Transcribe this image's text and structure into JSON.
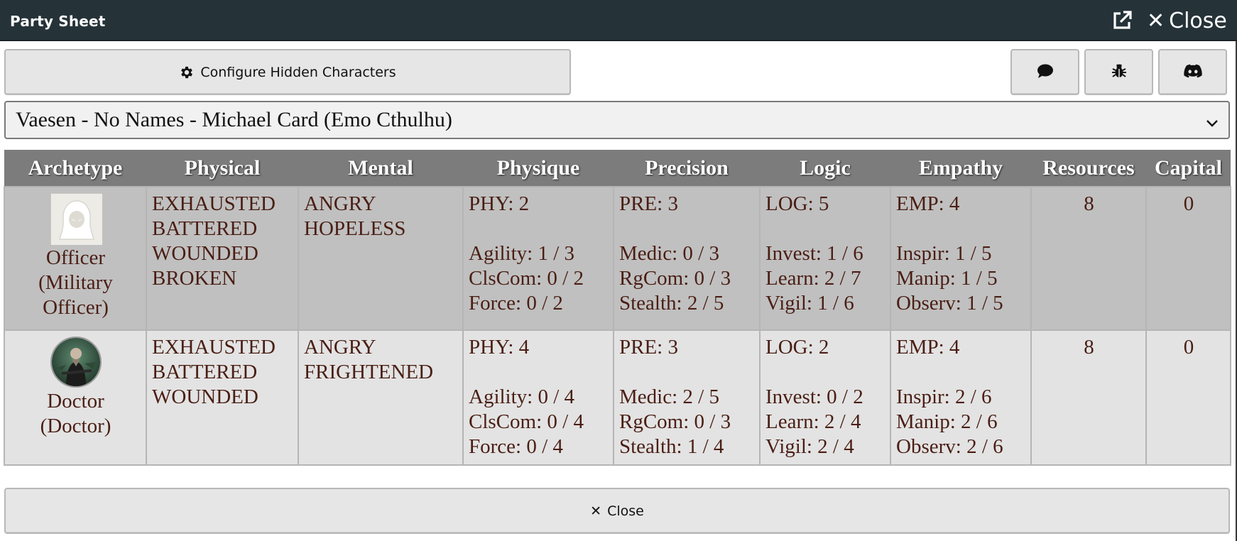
{
  "window": {
    "title": "Party Sheet",
    "close_label": "Close",
    "popout_icon": "external-link-icon",
    "close_icon": "close-icon"
  },
  "toolbar": {
    "configure_label": "Configure Hidden Characters",
    "configure_icon": "gear-icon",
    "chat_icon": "chat-bubble-icon",
    "bug_icon": "bug-icon",
    "discord_icon": "discord-icon"
  },
  "system_select": {
    "value": "Vaesen - No Names - Michael Card (Emo Cthulhu)"
  },
  "table": {
    "headers": [
      "Archetype",
      "Physical",
      "Mental",
      "Physique",
      "Precision",
      "Logic",
      "Empathy",
      "Resources",
      "Capital"
    ],
    "rows": [
      {
        "archetype": [
          "Officer",
          "(Military",
          "Officer)"
        ],
        "physical": [
          "EXHAUSTED",
          "BATTERED",
          "WOUNDED",
          "BROKEN"
        ],
        "mental": [
          "ANGRY",
          "HOPELESS"
        ],
        "physique": {
          "main": "PHY: 2",
          "skills": [
            "Agility: 1 / 3",
            "ClsCom: 0 / 2",
            "Force: 0 / 2"
          ]
        },
        "precision": {
          "main": "PRE: 3",
          "skills": [
            "Medic: 0 / 3",
            "RgCom: 0 / 3",
            "Stealth: 2 / 5"
          ]
        },
        "logic": {
          "main": "LOG: 5",
          "skills": [
            "Invest: 1 / 6",
            "Learn: 2 / 7",
            "Vigil: 1 / 6"
          ]
        },
        "empathy": {
          "main": "EMP: 4",
          "skills": [
            "Inspir: 1 / 5",
            "Manip: 1 / 5",
            "Observ: 1 / 5"
          ]
        },
        "resources": "8",
        "capital": "0"
      },
      {
        "archetype": [
          "Doctor",
          "(Doctor)"
        ],
        "physical": [
          "EXHAUSTED",
          "BATTERED",
          "WOUNDED"
        ],
        "mental": [
          "ANGRY",
          "FRIGHTENED"
        ],
        "physique": {
          "main": "PHY: 4",
          "skills": [
            "Agility: 0 / 4",
            "ClsCom: 0 / 4",
            "Force: 0 / 4"
          ]
        },
        "precision": {
          "main": "PRE: 3",
          "skills": [
            "Medic: 2 / 5",
            "RgCom: 0 / 3",
            "Stealth: 1 / 4"
          ]
        },
        "logic": {
          "main": "LOG: 2",
          "skills": [
            "Invest: 0 / 2",
            "Learn: 2 / 4",
            "Vigil: 2 / 4"
          ]
        },
        "empathy": {
          "main": "EMP: 4",
          "skills": [
            "Inspir: 2 / 6",
            "Manip: 2 / 6",
            "Observ: 2 / 6"
          ]
        },
        "resources": "8",
        "capital": "0"
      }
    ]
  },
  "footer": {
    "close_label": "Close"
  },
  "colors": {
    "titlebar": "#253238",
    "header_bg": "#7c7c7c",
    "row_a_bg": "#c0c0c0",
    "row_b_bg": "#e3e3e3",
    "cell_text": "#4a1e14"
  }
}
